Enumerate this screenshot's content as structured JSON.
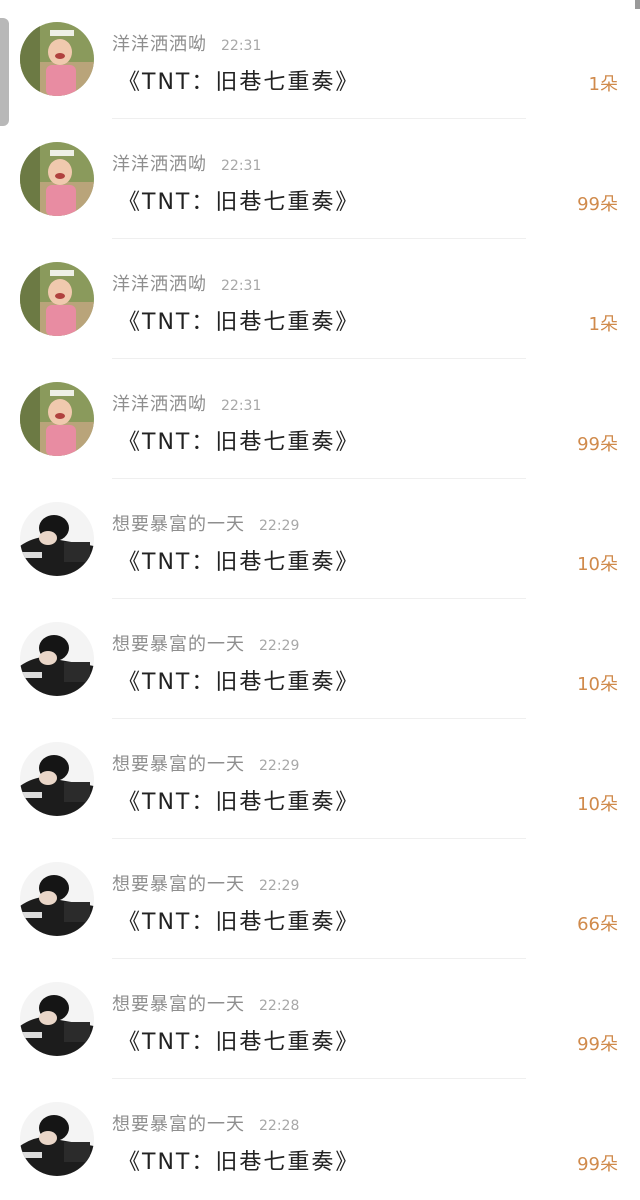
{
  "gift_list": {
    "items": [
      {
        "user": "洋洋洒洒呦",
        "time": "22:31",
        "gift": "《TNT：旧巷七重奏》",
        "count": "1朵",
        "avatar": "child-avatar"
      },
      {
        "user": "洋洋洒洒呦",
        "time": "22:31",
        "gift": "《TNT：旧巷七重奏》",
        "count": "99朵",
        "avatar": "child-avatar"
      },
      {
        "user": "洋洋洒洒呦",
        "time": "22:31",
        "gift": "《TNT：旧巷七重奏》",
        "count": "1朵",
        "avatar": "child-avatar"
      },
      {
        "user": "洋洋洒洒呦",
        "time": "22:31",
        "gift": "《TNT：旧巷七重奏》",
        "count": "99朵",
        "avatar": "child-avatar"
      },
      {
        "user": "想要暴富的一天",
        "time": "22:29",
        "gift": "《TNT：旧巷七重奏》",
        "count": "10朵",
        "avatar": "pianist-avatar"
      },
      {
        "user": "想要暴富的一天",
        "time": "22:29",
        "gift": "《TNT：旧巷七重奏》",
        "count": "10朵",
        "avatar": "pianist-avatar"
      },
      {
        "user": "想要暴富的一天",
        "time": "22:29",
        "gift": "《TNT：旧巷七重奏》",
        "count": "10朵",
        "avatar": "pianist-avatar"
      },
      {
        "user": "想要暴富的一天",
        "time": "22:29",
        "gift": "《TNT：旧巷七重奏》",
        "count": "66朵",
        "avatar": "pianist-avatar"
      },
      {
        "user": "想要暴富的一天",
        "time": "22:28",
        "gift": "《TNT：旧巷七重奏》",
        "count": "99朵",
        "avatar": "pianist-avatar"
      },
      {
        "user": "想要暴富的一天",
        "time": "22:28",
        "gift": "《TNT：旧巷七重奏》",
        "count": "99朵",
        "avatar": "pianist-avatar"
      }
    ]
  },
  "colors": {
    "count_accent": "#d08a4b",
    "username": "#8e8e8e",
    "title": "#222222"
  }
}
